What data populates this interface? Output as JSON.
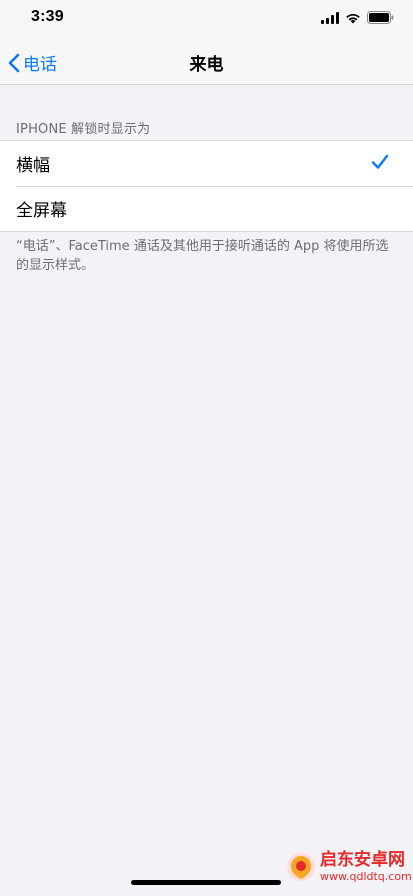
{
  "status_bar": {
    "time": "3:39",
    "icons": [
      "signal-icon",
      "wifi-icon",
      "battery-icon"
    ]
  },
  "navbar": {
    "back_label": "电话",
    "title": "来电"
  },
  "section": {
    "header": "IPHONE 解锁时显示为",
    "options": [
      {
        "label": "横幅",
        "selected": true
      },
      {
        "label": "全屏幕",
        "selected": false
      }
    ],
    "footer": "“电话”、FaceTime 通话及其他用于接听通话的 App 将使用所选的显示样式。"
  },
  "watermark": {
    "title": "启东安卓网",
    "url": "www.qdldtq.com"
  },
  "colors": {
    "accent": "#0a7aff",
    "background": "#f2f2f7",
    "watermark": "#e52a2a"
  }
}
